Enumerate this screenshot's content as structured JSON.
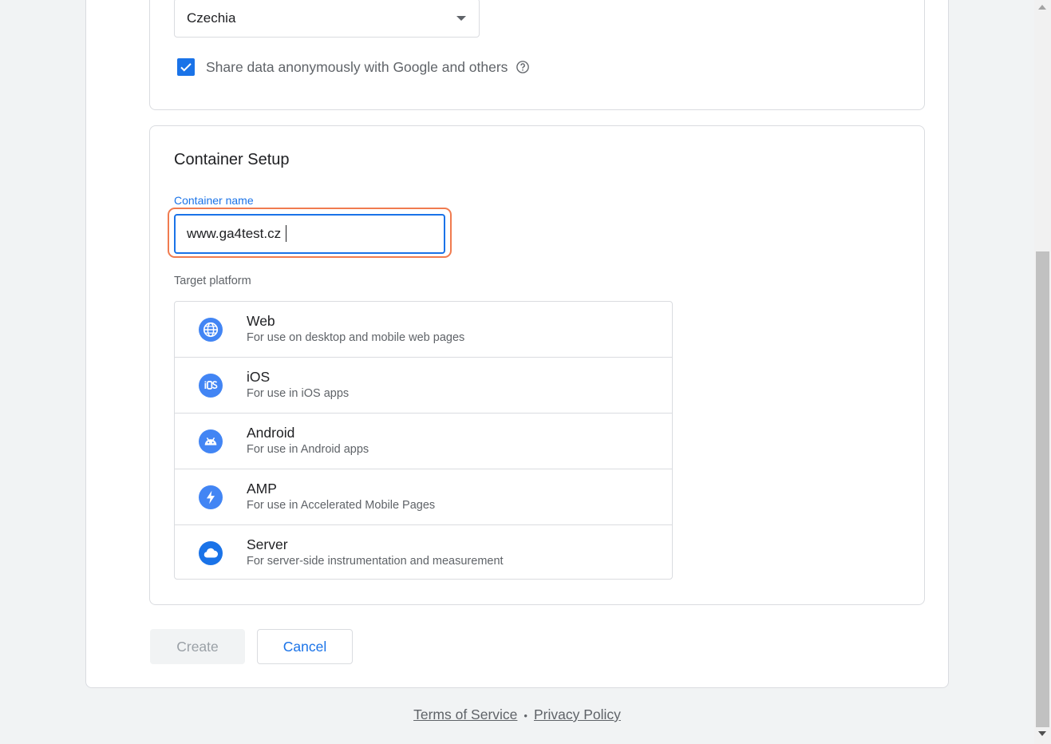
{
  "account": {
    "country_value": "Czechia",
    "share_label": "Share data anonymously with Google and others",
    "share_checked": true
  },
  "container": {
    "section_title": "Container Setup",
    "name_label": "Container name",
    "name_value": "www.ga4test.cz",
    "platform_label": "Target platform",
    "platforms": [
      {
        "name": "Web",
        "desc": "For use on desktop and mobile web pages",
        "icon": "globe-icon"
      },
      {
        "name": "iOS",
        "desc": "For use in iOS apps",
        "icon": "ios-icon"
      },
      {
        "name": "Android",
        "desc": "For use in Android apps",
        "icon": "android-icon"
      },
      {
        "name": "AMP",
        "desc": "For use in Accelerated Mobile Pages",
        "icon": "amp-bolt-icon"
      },
      {
        "name": "Server",
        "desc": "For server-side instrumentation and measurement",
        "icon": "cloud-icon"
      }
    ]
  },
  "actions": {
    "create_label": "Create",
    "cancel_label": "Cancel"
  },
  "footer": {
    "terms_label": "Terms of Service",
    "separator": "•",
    "privacy_label": "Privacy Policy"
  },
  "colors": {
    "accent": "#1a73e8",
    "icon_blue": "#4285f4",
    "highlight": "#f07b4f"
  }
}
